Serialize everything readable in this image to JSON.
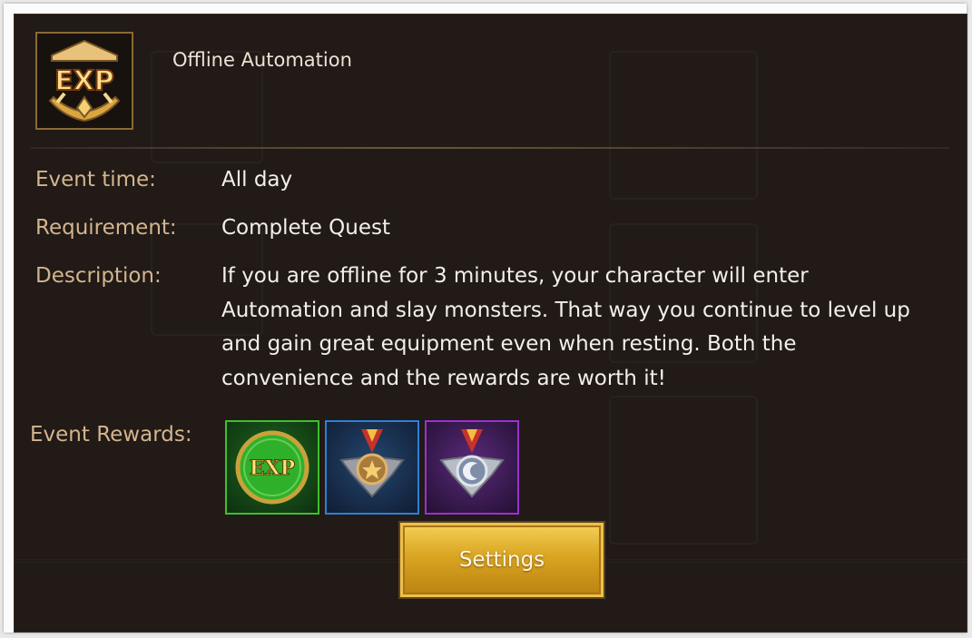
{
  "event": {
    "title": "Offline Automation",
    "icon": "exp-badge-icon",
    "time_label": "Event time:",
    "time_value": "All day",
    "requirement_label": "Requirement:",
    "requirement_value": "Complete Quest",
    "description_label": "Description:",
    "description_text": "If you are offline for 3 minutes, your character will enter Automation and slay monsters. That way you continue to level up and gain great equipment even when resting. Both the convenience and the rewards are worth it!",
    "rewards_label": "Event Rewards:",
    "rewards": [
      {
        "icon": "exp-orb-icon",
        "icon_text": "EXP",
        "color": "#3fbf2e"
      },
      {
        "icon": "bronze-medal-icon",
        "color": "#2e7fd6"
      },
      {
        "icon": "silver-moon-medal-icon",
        "color": "#9e2fd0"
      }
    ],
    "settings_button": "Settings",
    "icon_text": "EXP"
  }
}
